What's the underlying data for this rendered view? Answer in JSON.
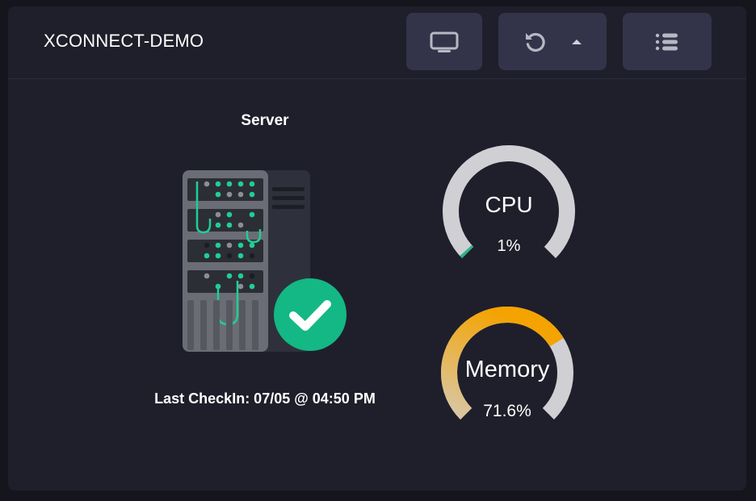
{
  "header": {
    "title": "XCONNECT-DEMO"
  },
  "toolbar": {
    "monitor_icon": "monitor-icon",
    "refresh_icon": "refresh-icon",
    "caret_icon": "caret-up-icon",
    "list_icon": "list-icon"
  },
  "server": {
    "label": "Server",
    "status_icon": "check-circle-icon",
    "last_checkin": "Last CheckIn: 07/05 @ 04:50 PM"
  },
  "gauges": {
    "cpu": {
      "label": "CPU",
      "value_text": "1%",
      "percent": 1,
      "color": "#2bb38a"
    },
    "memory": {
      "label": "Memory",
      "value_text": "71.6%",
      "percent": 71.6,
      "color": "#f4a300"
    }
  },
  "colors": {
    "background": "#15151d",
    "card": "#1f1f2b",
    "button": "#33334a",
    "gauge_track": "#d0d0d4",
    "accent_green": "#14b884"
  }
}
